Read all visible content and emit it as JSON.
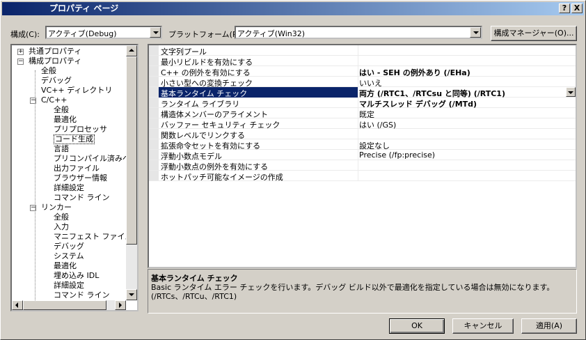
{
  "window": {
    "title": "プロパティ ページ",
    "help_button": "?",
    "close_button": "X"
  },
  "toolbar": {
    "config_label": "構成(C):",
    "config_value": "アクティブ(Debug)",
    "platform_label": "プラットフォーム(P):",
    "platform_value": "アクティブ(Win32)",
    "config_manager_button": "構成マネージャー(O)..."
  },
  "tree": [
    {
      "label": "共通プロパティ",
      "level": 0,
      "expander": "+"
    },
    {
      "label": "構成プロパティ",
      "level": 0,
      "expander": "−"
    },
    {
      "label": "全般",
      "level": 1
    },
    {
      "label": "デバッグ",
      "level": 1
    },
    {
      "label": "VC++ ディレクトリ",
      "level": 1
    },
    {
      "label": "C/C++",
      "level": 1,
      "expander": "−"
    },
    {
      "label": "全般",
      "level": 2
    },
    {
      "label": "最適化",
      "level": 2
    },
    {
      "label": "プリプロセッサ",
      "level": 2
    },
    {
      "label": "コード生成",
      "level": 2,
      "selected": true
    },
    {
      "label": "言語",
      "level": 2
    },
    {
      "label": "プリコンパイル済みヘッダー",
      "level": 2
    },
    {
      "label": "出力ファイル",
      "level": 2
    },
    {
      "label": "ブラウザー情報",
      "level": 2
    },
    {
      "label": "詳細設定",
      "level": 2
    },
    {
      "label": "コマンド ライン",
      "level": 2
    },
    {
      "label": "リンカー",
      "level": 1,
      "expander": "−"
    },
    {
      "label": "全般",
      "level": 2
    },
    {
      "label": "入力",
      "level": 2
    },
    {
      "label": "マニフェスト ファイル",
      "level": 2
    },
    {
      "label": "デバッグ",
      "level": 2
    },
    {
      "label": "システム",
      "level": 2
    },
    {
      "label": "最適化",
      "level": 2
    },
    {
      "label": "埋め込み IDL",
      "level": 2
    },
    {
      "label": "詳細設定",
      "level": 2
    },
    {
      "label": "コマンド ライン",
      "level": 2
    }
  ],
  "properties": [
    {
      "name": "文字列プール",
      "value": "",
      "bold": false
    },
    {
      "name": "最小リビルドを有効にする",
      "value": "",
      "bold": false
    },
    {
      "name": "C++ の例外を有効にする",
      "value": "はい - SEH の例外あり (/EHa)",
      "bold": true
    },
    {
      "name": "小さい型への変換チェック",
      "value": "いいえ",
      "bold": false
    },
    {
      "name": "基本ランタイム チェック",
      "value": "両方 (/RTC1、/RTCsu と同等) (/RTC1)",
      "bold": true,
      "selected": true
    },
    {
      "name": "ランタイム ライブラリ",
      "value": "マルチスレッド デバッグ (/MTd)",
      "bold": true
    },
    {
      "name": "構造体メンバーのアライメント",
      "value": "既定",
      "bold": false
    },
    {
      "name": "バッファー セキュリティ チェック",
      "value": "はい (/GS)",
      "bold": false
    },
    {
      "name": "関数レベルでリンクする",
      "value": "",
      "bold": false
    },
    {
      "name": "拡張命令セットを有効にする",
      "value": "設定なし",
      "bold": false
    },
    {
      "name": "浮動小数点モデル",
      "value": "Precise (/fp:precise)",
      "bold": false
    },
    {
      "name": "浮動小数点の例外を有効にする",
      "value": "",
      "bold": false
    },
    {
      "name": "ホットパッチ可能なイメージの作成",
      "value": "",
      "bold": false
    }
  ],
  "description": {
    "title": "基本ランタイム チェック",
    "text": "Basic ランタイム エラー チェックを行います。デバッグ ビルド以外で最適化を指定している場合は無効になります。　(/RTCs、/RTCu、/RTC1)"
  },
  "buttons": {
    "ok": "OK",
    "cancel": "キャンセル",
    "apply": "適用(A)"
  }
}
